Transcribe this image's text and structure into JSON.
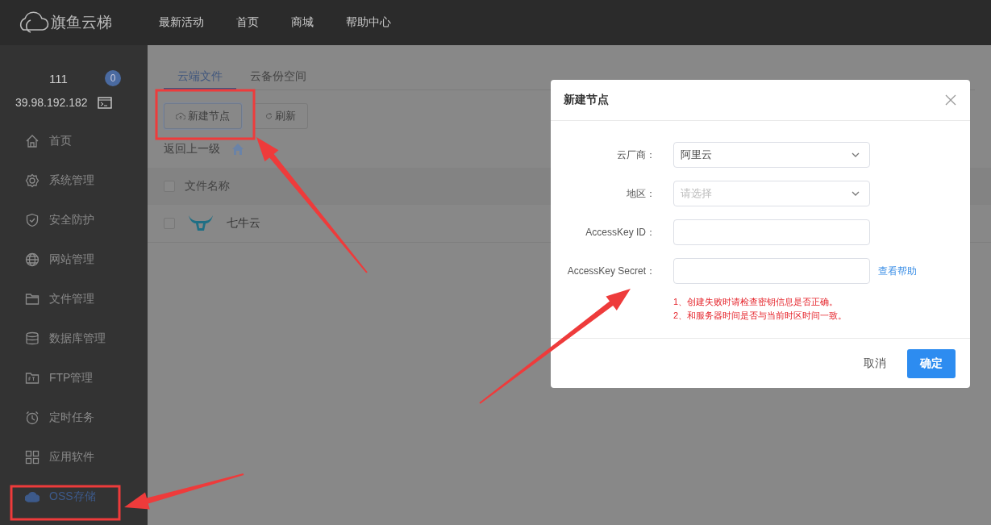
{
  "topbar": {
    "brand": "旗鱼云梯",
    "nav": [
      "最新活动",
      "首页",
      "商城",
      "帮助中心"
    ]
  },
  "sidebar": {
    "user": "111",
    "badge": "0",
    "ip": "39.98.192.182",
    "items": [
      {
        "label": "首页",
        "kind": "home",
        "selected": false
      },
      {
        "label": "系统管理",
        "kind": "gear",
        "selected": false
      },
      {
        "label": "安全防护",
        "kind": "shield",
        "selected": false
      },
      {
        "label": "网站管理",
        "kind": "globe",
        "selected": false
      },
      {
        "label": "文件管理",
        "kind": "folder",
        "selected": false
      },
      {
        "label": "数据库管理",
        "kind": "database",
        "selected": false
      },
      {
        "label": "FTP管理",
        "kind": "ftp",
        "selected": false
      },
      {
        "label": "定时任务",
        "kind": "clock",
        "selected": false
      },
      {
        "label": "应用软件",
        "kind": "apps",
        "selected": false
      },
      {
        "label": "OSS存储",
        "kind": "cloud",
        "selected": true
      }
    ]
  },
  "tabs": [
    {
      "label": "云端文件",
      "selected": true
    },
    {
      "label": "云备份空间",
      "selected": false
    }
  ],
  "toolbar": {
    "buttons": [
      {
        "label": "新建节点",
        "kind": "upload"
      },
      {
        "label": "刷新",
        "kind": "refresh"
      }
    ]
  },
  "breadcrumb": {
    "back": "返回上一级"
  },
  "table": {
    "columns": [
      {
        "label": "文件名称",
        "checked": false
      }
    ],
    "rows": [
      {
        "name": "七牛云",
        "checked": false
      }
    ]
  },
  "dialog": {
    "title": "新建节点",
    "fields": [
      {
        "label": "云厂商：",
        "kind": "select",
        "value": "阿里云"
      },
      {
        "label": "地区：",
        "kind": "select",
        "placeholder": "请选择"
      },
      {
        "label": "AccessKey ID：",
        "kind": "input"
      },
      {
        "label": "AccessKey Secret：",
        "kind": "input",
        "link": "查看帮助"
      }
    ],
    "notes": [
      "1、创建失败时请检查密钥信息是否正确。",
      "2、和服务器时间是否与当前时区时间一致。"
    ],
    "cancel": "取消",
    "confirm": "确定"
  }
}
